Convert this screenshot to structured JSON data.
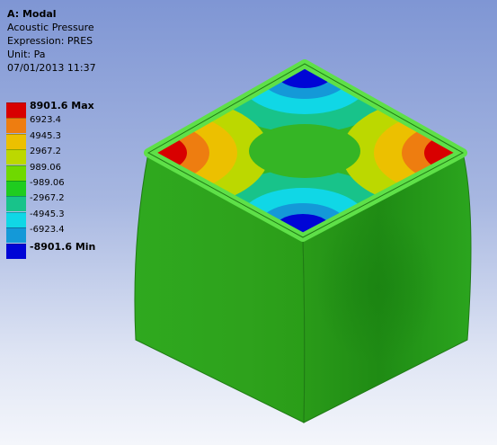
{
  "info": {
    "title": "A: Modal",
    "result": "Acoustic Pressure",
    "expression": "Expression: PRES",
    "unit": "Unit: Pa",
    "timestamp": "07/01/2013 11:37"
  },
  "legend": {
    "labels": [
      "8901.6 Max",
      "6923.4",
      "4945.3",
      "2967.2",
      "989.06",
      "-989.06",
      "-2967.2",
      "-4945.3",
      "-6923.4",
      "-8901.6 Min"
    ],
    "colors": [
      "#d80000",
      "#ee7d10",
      "#ecc000",
      "#bcd800",
      "#6fd900",
      "#1fcc1f",
      "#18c38a",
      "#10d7e6",
      "#1499d8",
      "#0005d6"
    ]
  },
  "model": {
    "name": "acoustic-cube",
    "colors": {
      "side_light": "#2ea51e",
      "side_dark": "#1f8f14",
      "top_base": "#35b525",
      "top_border": "#56d840",
      "max": "#d80000",
      "high": "#ee7d10",
      "mid_high": "#c7c600",
      "mid_low": "#18c38a",
      "low": "#10d7e6",
      "min": "#0005d6"
    }
  }
}
